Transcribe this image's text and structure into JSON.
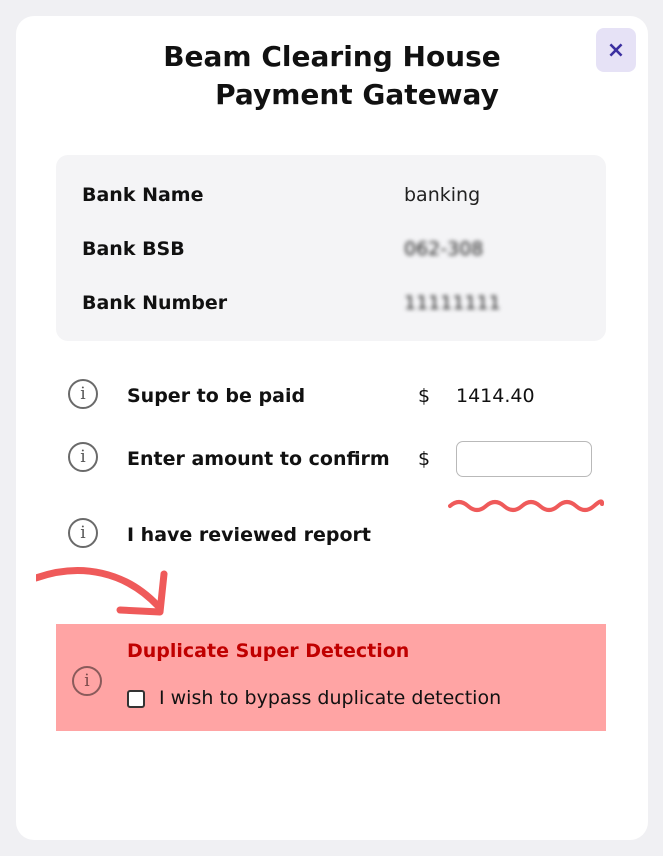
{
  "dialog": {
    "title_line1": "Beam Clearing House",
    "title_line2": "Payment Gateway",
    "close_glyph": "×"
  },
  "bank": {
    "rows": [
      {
        "label": "Bank Name",
        "value": "banking"
      },
      {
        "label": "Bank BSB",
        "value": "062-308"
      },
      {
        "label": "Bank Number",
        "value": "11111111"
      }
    ]
  },
  "payment": {
    "super_label": "Super to be paid",
    "currency": "$",
    "super_amount": "1414.40",
    "confirm_label": "Enter amount to confirm",
    "confirm_value": "",
    "reviewed_label": "I have reviewed report"
  },
  "duplicate": {
    "title": "Duplicate Super Detection",
    "bypass_label": "I wish to bypass duplicate detection",
    "bypass_checked": false
  },
  "icons": {
    "info": "info-circle-icon",
    "close": "close-icon"
  },
  "colors": {
    "accent": "#3b2fa0",
    "warning_bg": "#ffa4a4",
    "warning_text": "#c00000",
    "annotation": "#ef5a5a"
  }
}
